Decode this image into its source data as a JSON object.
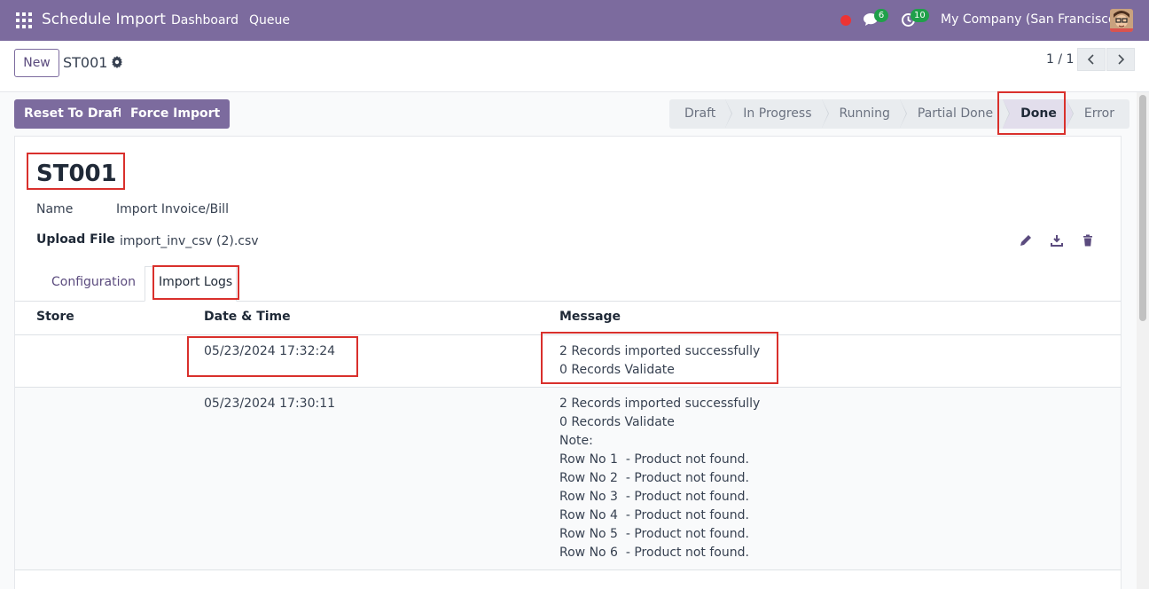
{
  "navbar": {
    "app_title": "Schedule Import",
    "links": [
      "Dashboard",
      "Queue"
    ],
    "messages_count": "6",
    "activities_count": "10",
    "company": "My Company (San Francisco)"
  },
  "control_panel": {
    "new_label": "New",
    "breadcrumb": "ST001",
    "pager": "1 / 1"
  },
  "actions": {
    "reset_label": "Reset To Draft",
    "force_label": "Force Import"
  },
  "stages": [
    {
      "label": "Draft",
      "active": false
    },
    {
      "label": "In Progress",
      "active": false
    },
    {
      "label": "Running",
      "active": false
    },
    {
      "label": "Partial Done",
      "active": false
    },
    {
      "label": "Done",
      "active": true
    },
    {
      "label": "Error",
      "active": false
    }
  ],
  "record": {
    "title": "ST001",
    "name_label": "Name",
    "name_value": "Import Invoice/Bill",
    "upload_label": "Upload File",
    "upload_value": "import_inv_csv (2).csv"
  },
  "tabs": {
    "configuration": "Configuration",
    "import_logs": "Import Logs"
  },
  "log_table": {
    "headers": [
      "Store",
      "Date & Time",
      "Message"
    ],
    "rows": [
      {
        "store": "",
        "datetime": "05/23/2024 17:32:24",
        "message": "2 Records imported successfully\n0 Records Validate"
      },
      {
        "store": "",
        "datetime": "05/23/2024 17:30:11",
        "message": "2 Records imported successfully\n0 Records Validate\nNote:\nRow No 1  - Product not found.\nRow No 2  - Product not found.\nRow No 3  - Product not found.\nRow No 4  - Product not found.\nRow No 5  - Product not found.\nRow No 6  - Product not found."
      }
    ]
  },
  "colors": {
    "brand": "#7c6b9e",
    "highlight": "#d9302c",
    "badge": "#20a04a"
  }
}
